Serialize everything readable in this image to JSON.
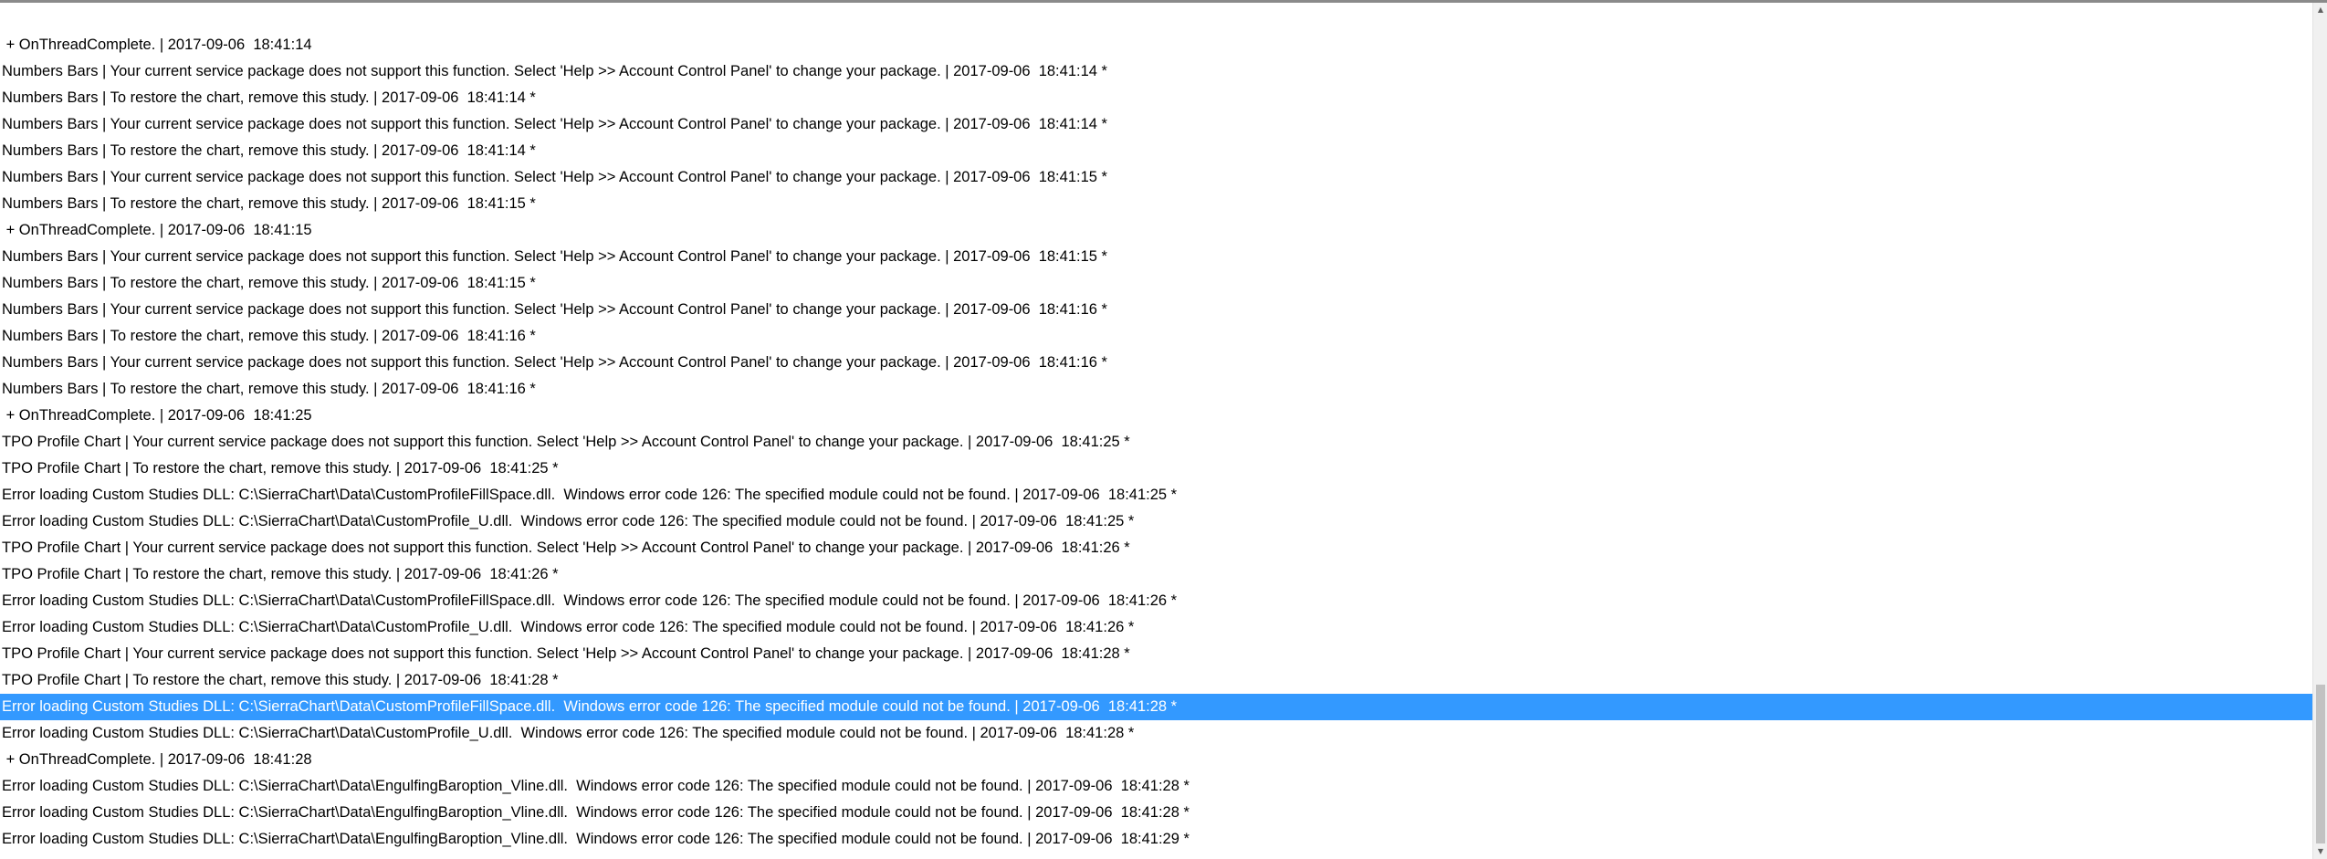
{
  "log": {
    "lines": [
      " + OnThreadComplete. | 2017-09-06  18:41:14",
      "Numbers Bars | Your current service package does not support this function. Select 'Help >> Account Control Panel' to change your package. | 2017-09-06  18:41:14 *",
      "Numbers Bars | To restore the chart, remove this study. | 2017-09-06  18:41:14 *",
      "Numbers Bars | Your current service package does not support this function. Select 'Help >> Account Control Panel' to change your package. | 2017-09-06  18:41:14 *",
      "Numbers Bars | To restore the chart, remove this study. | 2017-09-06  18:41:14 *",
      "Numbers Bars | Your current service package does not support this function. Select 'Help >> Account Control Panel' to change your package. | 2017-09-06  18:41:15 *",
      "Numbers Bars | To restore the chart, remove this study. | 2017-09-06  18:41:15 *",
      " + OnThreadComplete. | 2017-09-06  18:41:15",
      "Numbers Bars | Your current service package does not support this function. Select 'Help >> Account Control Panel' to change your package. | 2017-09-06  18:41:15 *",
      "Numbers Bars | To restore the chart, remove this study. | 2017-09-06  18:41:15 *",
      "Numbers Bars | Your current service package does not support this function. Select 'Help >> Account Control Panel' to change your package. | 2017-09-06  18:41:16 *",
      "Numbers Bars | To restore the chart, remove this study. | 2017-09-06  18:41:16 *",
      "Numbers Bars | Your current service package does not support this function. Select 'Help >> Account Control Panel' to change your package. | 2017-09-06  18:41:16 *",
      "Numbers Bars | To restore the chart, remove this study. | 2017-09-06  18:41:16 *",
      " + OnThreadComplete. | 2017-09-06  18:41:25",
      "TPO Profile Chart | Your current service package does not support this function. Select 'Help >> Account Control Panel' to change your package. | 2017-09-06  18:41:25 *",
      "TPO Profile Chart | To restore the chart, remove this study. | 2017-09-06  18:41:25 *",
      "Error loading Custom Studies DLL: C:\\SierraChart\\Data\\CustomProfileFillSpace.dll.  Windows error code 126: The specified module could not be found. | 2017-09-06  18:41:25 *",
      "Error loading Custom Studies DLL: C:\\SierraChart\\Data\\CustomProfile_U.dll.  Windows error code 126: The specified module could not be found. | 2017-09-06  18:41:25 *",
      "TPO Profile Chart | Your current service package does not support this function. Select 'Help >> Account Control Panel' to change your package. | 2017-09-06  18:41:26 *",
      "TPO Profile Chart | To restore the chart, remove this study. | 2017-09-06  18:41:26 *",
      "Error loading Custom Studies DLL: C:\\SierraChart\\Data\\CustomProfileFillSpace.dll.  Windows error code 126: The specified module could not be found. | 2017-09-06  18:41:26 *",
      "Error loading Custom Studies DLL: C:\\SierraChart\\Data\\CustomProfile_U.dll.  Windows error code 126: The specified module could not be found. | 2017-09-06  18:41:26 *",
      "TPO Profile Chart | Your current service package does not support this function. Select 'Help >> Account Control Panel' to change your package. | 2017-09-06  18:41:28 *",
      "TPO Profile Chart | To restore the chart, remove this study. | 2017-09-06  18:41:28 *",
      "Error loading Custom Studies DLL: C:\\SierraChart\\Data\\CustomProfileFillSpace.dll.  Windows error code 126: The specified module could not be found. | 2017-09-06  18:41:28 *",
      "Error loading Custom Studies DLL: C:\\SierraChart\\Data\\CustomProfile_U.dll.  Windows error code 126: The specified module could not be found. | 2017-09-06  18:41:28 *",
      " + OnThreadComplete. | 2017-09-06  18:41:28",
      "Error loading Custom Studies DLL: C:\\SierraChart\\Data\\EngulfingBaroption_Vline.dll.  Windows error code 126: The specified module could not be found. | 2017-09-06  18:41:28 *",
      "Error loading Custom Studies DLL: C:\\SierraChart\\Data\\EngulfingBaroption_Vline.dll.  Windows error code 126: The specified module could not be found. | 2017-09-06  18:41:28 *",
      "Error loading Custom Studies DLL: C:\\SierraChart\\Data\\EngulfingBaroption_Vline.dll.  Windows error code 126: The specified module could not be found. | 2017-09-06  18:41:29 *"
    ],
    "selected_index": 25,
    "selection_color": "#3399ff",
    "selected_text_color": "#ffffff",
    "text_color": "#000000"
  },
  "scrollbar": {
    "up_icon": "scroll-up-arrow-icon",
    "down_icon": "scroll-down-arrow-icon",
    "thumb_color": "#c2c2c2"
  }
}
